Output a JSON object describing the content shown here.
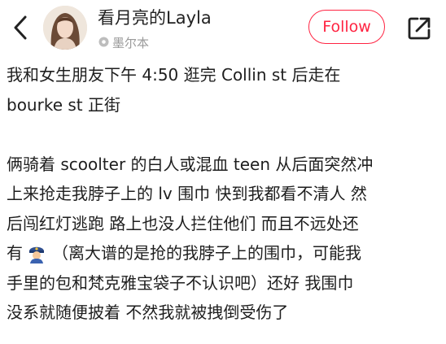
{
  "header": {
    "author_name": "看月亮的Layla",
    "location": "墨尔本",
    "follow_label": "Follow"
  },
  "post": {
    "paragraph1_lines": [
      "我和女生朋友下午 4:50 逛完 Collin st 后走在",
      "bourke st 正街"
    ],
    "paragraph2_lines": [
      "俩骑着 scoolter 的白人或混血 teen 从后面突然冲",
      "上来抢走我脖子上的 lv 围巾 快到我都看不清人 然",
      "后闯红灯逃跑 路上也没人拦住他们 而且不远处还",
      "（离大谱的是抢的我脖子上的围巾，可能我",
      "手里的包和梵克雅宝袋子不认识吧）还好 我围巾",
      "没系就随便披着 不然我就被拽倒受伤了"
    ],
    "line_you": "有"
  },
  "colors": {
    "accent": "#ff2442",
    "muted": "#9a9a9a",
    "text": "#1e1e1e"
  },
  "icons": [
    "back-chevron-icon",
    "location-pin-icon",
    "share-icon",
    "police-officer-emoji-icon"
  ]
}
